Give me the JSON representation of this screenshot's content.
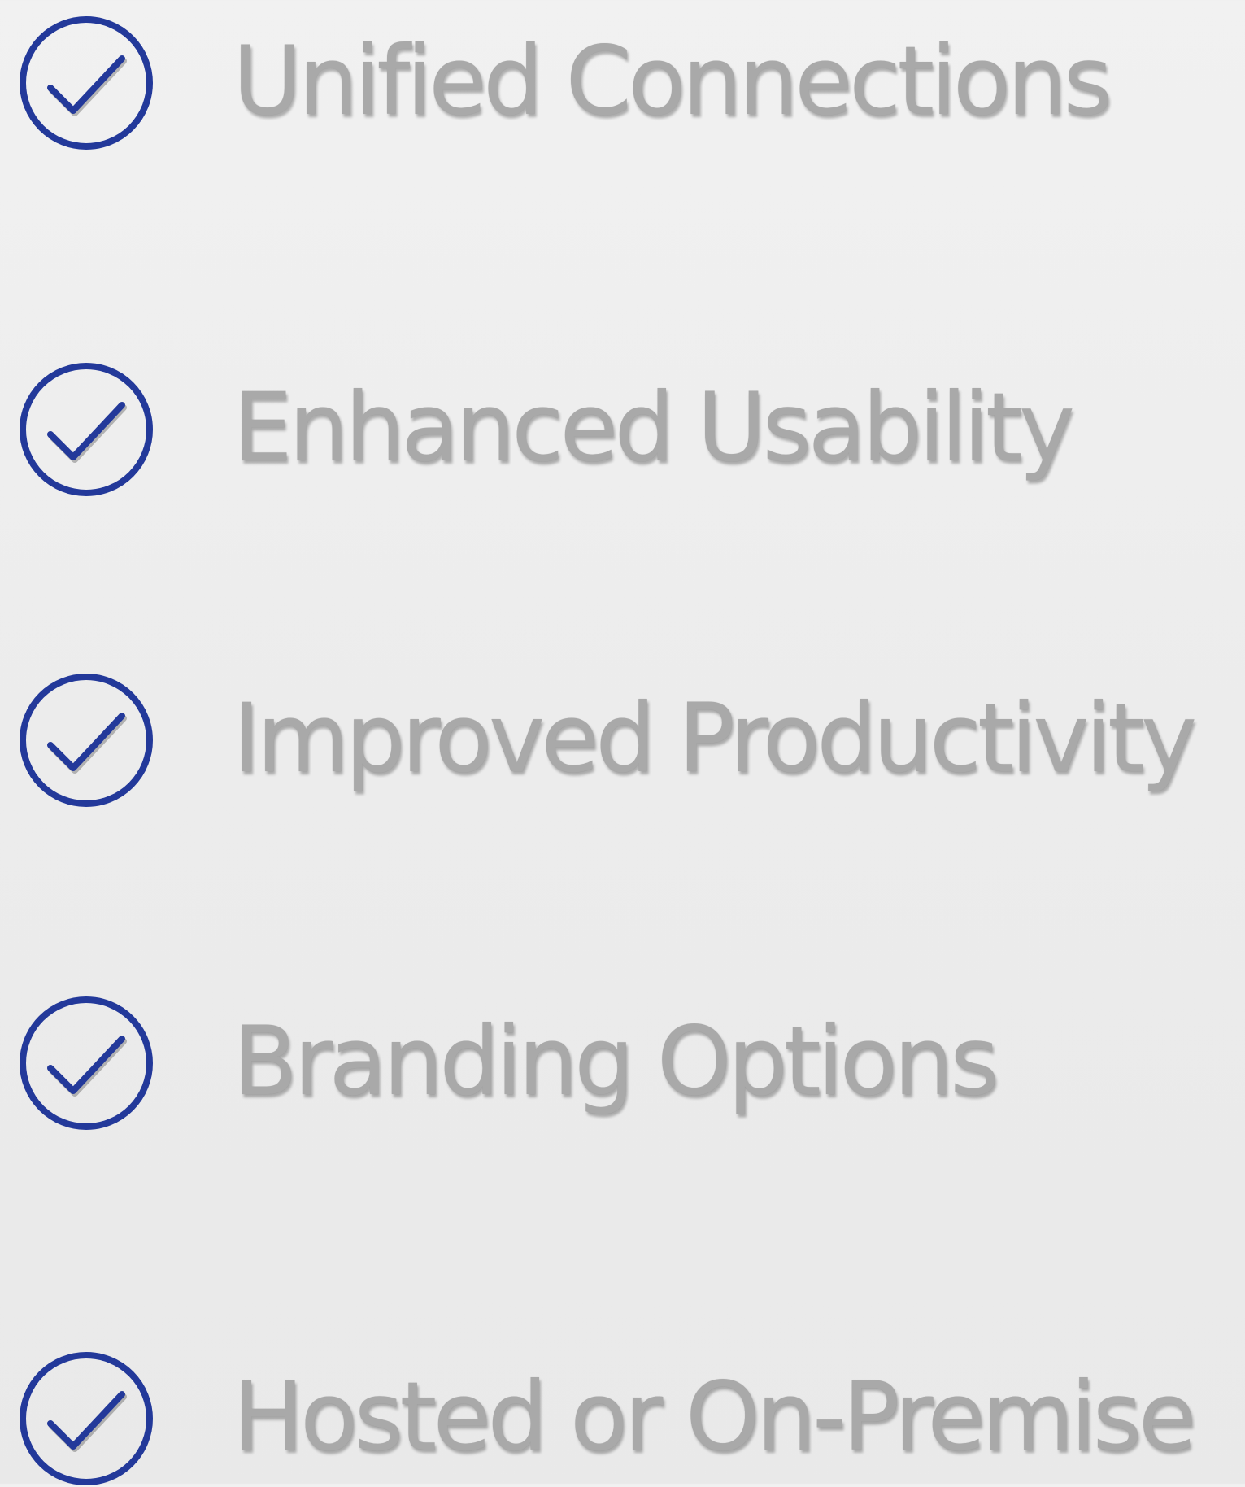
{
  "features": [
    {
      "label": "Unified Connections",
      "icon": "check-circle-icon"
    },
    {
      "label": "Enhanced Usability",
      "icon": "check-circle-icon"
    },
    {
      "label": "Improved Productivity",
      "icon": "check-circle-icon"
    },
    {
      "label": "Branding Options",
      "icon": "check-circle-icon"
    },
    {
      "label": "Hosted or On-Premise",
      "icon": "check-circle-icon"
    }
  ],
  "colors": {
    "icon_stroke": "#23399a",
    "text": "#a9a9a9",
    "background": "#ececec"
  }
}
